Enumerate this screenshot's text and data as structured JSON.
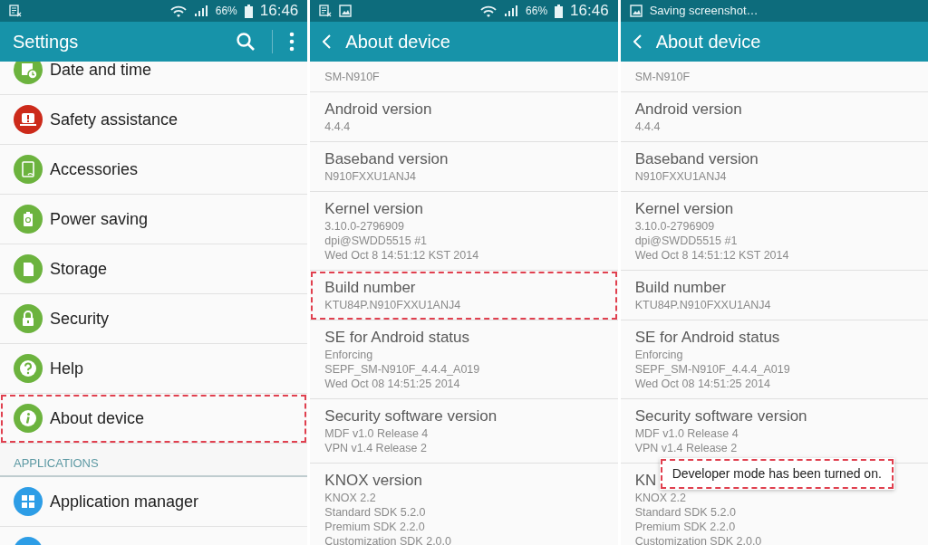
{
  "screens": [
    {
      "kind": "settings",
      "status_bar": {
        "notifications": [
          {
            "kind": "document"
          }
        ],
        "battery": "66%",
        "time": "16:46"
      },
      "app_bar": {
        "title": "Settings"
      },
      "items": [
        {
          "kind": "item",
          "label": "Date and time",
          "color": "#6cb33e",
          "highlighted": false
        },
        {
          "kind": "item",
          "label": "Safety assistance",
          "color": "#cc2a1a",
          "highlighted": false
        },
        {
          "kind": "item",
          "label": "Accessories",
          "color": "#6cb33e",
          "highlighted": false
        },
        {
          "kind": "item",
          "label": "Power saving",
          "color": "#6cb33e",
          "highlighted": false
        },
        {
          "kind": "item",
          "label": "Storage",
          "color": "#6cb33e",
          "highlighted": false
        },
        {
          "kind": "item",
          "label": "Security",
          "color": "#6cb33e",
          "highlighted": false
        },
        {
          "kind": "item",
          "label": "Help",
          "color": "#6cb33e",
          "highlighted": false
        },
        {
          "kind": "item",
          "label": "About device",
          "color": "#6cb33e",
          "highlighted": true
        },
        {
          "kind": "header",
          "label": "APPLICATIONS"
        },
        {
          "kind": "item",
          "label": "Application manager",
          "color": "#2d9de6",
          "highlighted": false
        },
        {
          "kind": "item",
          "color": "#2d9de6",
          "highlighted": false
        }
      ]
    },
    {
      "kind": "about",
      "status_bar": {
        "notifications": [
          {
            "kind": "document"
          },
          {
            "kind": "image"
          }
        ],
        "battery": "66%",
        "time": "16:46"
      },
      "app_bar": {
        "title": "About device"
      },
      "items": [
        {
          "values": [
            "SM-N910F"
          ],
          "highlighted": false
        },
        {
          "title": "Android version",
          "values": [
            "4.4.4"
          ],
          "highlighted": false
        },
        {
          "title": "Baseband version",
          "values": [
            "N910FXXU1ANJ4"
          ],
          "highlighted": false
        },
        {
          "title": "Kernel version",
          "values": [
            "3.10.0-2796909",
            "dpi@SWDD5515 #1",
            "Wed Oct 8 14:51:12 KST 2014"
          ],
          "highlighted": false
        },
        {
          "title": "Build number",
          "values": [
            "KTU84P.N910FXXU1ANJ4"
          ],
          "highlighted": true
        },
        {
          "title": "SE for Android status",
          "values": [
            "Enforcing",
            "SEPF_SM-N910F_4.4.4_A019",
            "Wed Oct 08 14:51:25 2014"
          ],
          "highlighted": false
        },
        {
          "title": "Security software version",
          "values": [
            "MDF v1.0 Release 4",
            "VPN v1.4 Release 2"
          ],
          "highlighted": false
        },
        {
          "title": "KNOX version",
          "values": [
            "KNOX 2.2",
            "Standard SDK 5.2.0",
            "Premium SDK 2.2.0",
            "Customization SDK 2.0.0"
          ],
          "highlighted": false
        }
      ]
    },
    {
      "kind": "about",
      "status_bar": {
        "notifications": [
          {
            "kind": "image",
            "text": "Saving screenshot…"
          }
        ]
      },
      "app_bar": {
        "title": "About device"
      },
      "items": [
        {
          "values": [
            "SM-N910F"
          ],
          "highlighted": false
        },
        {
          "title": "Android version",
          "values": [
            "4.4.4"
          ],
          "highlighted": false
        },
        {
          "title": "Baseband version",
          "values": [
            "N910FXXU1ANJ4"
          ],
          "highlighted": false
        },
        {
          "title": "Kernel version",
          "values": [
            "3.10.0-2796909",
            "dpi@SWDD5515 #1",
            "Wed Oct 8 14:51:12 KST 2014"
          ],
          "highlighted": false
        },
        {
          "title": "Build number",
          "values": [
            "KTU84P.N910FXXU1ANJ4"
          ],
          "highlighted": false
        },
        {
          "title": "SE for Android status",
          "values": [
            "Enforcing",
            "SEPF_SM-N910F_4.4.4_A019",
            "Wed Oct 08 14:51:25 2014"
          ],
          "highlighted": false
        },
        {
          "title": "Security software version",
          "values": [
            "MDF v1.0 Release 4",
            "VPN v1.4 Release 2"
          ],
          "highlighted": false
        },
        {
          "title": "KN",
          "values": [
            "KNOX 2.2",
            "Standard SDK 5.2.0",
            "Premium SDK 2.2.0",
            "Customization SDK 2.0.0"
          ],
          "highlighted": false
        }
      ],
      "toast": {
        "text": "Developer mode has been turned on.",
        "highlighted": true
      }
    }
  ]
}
